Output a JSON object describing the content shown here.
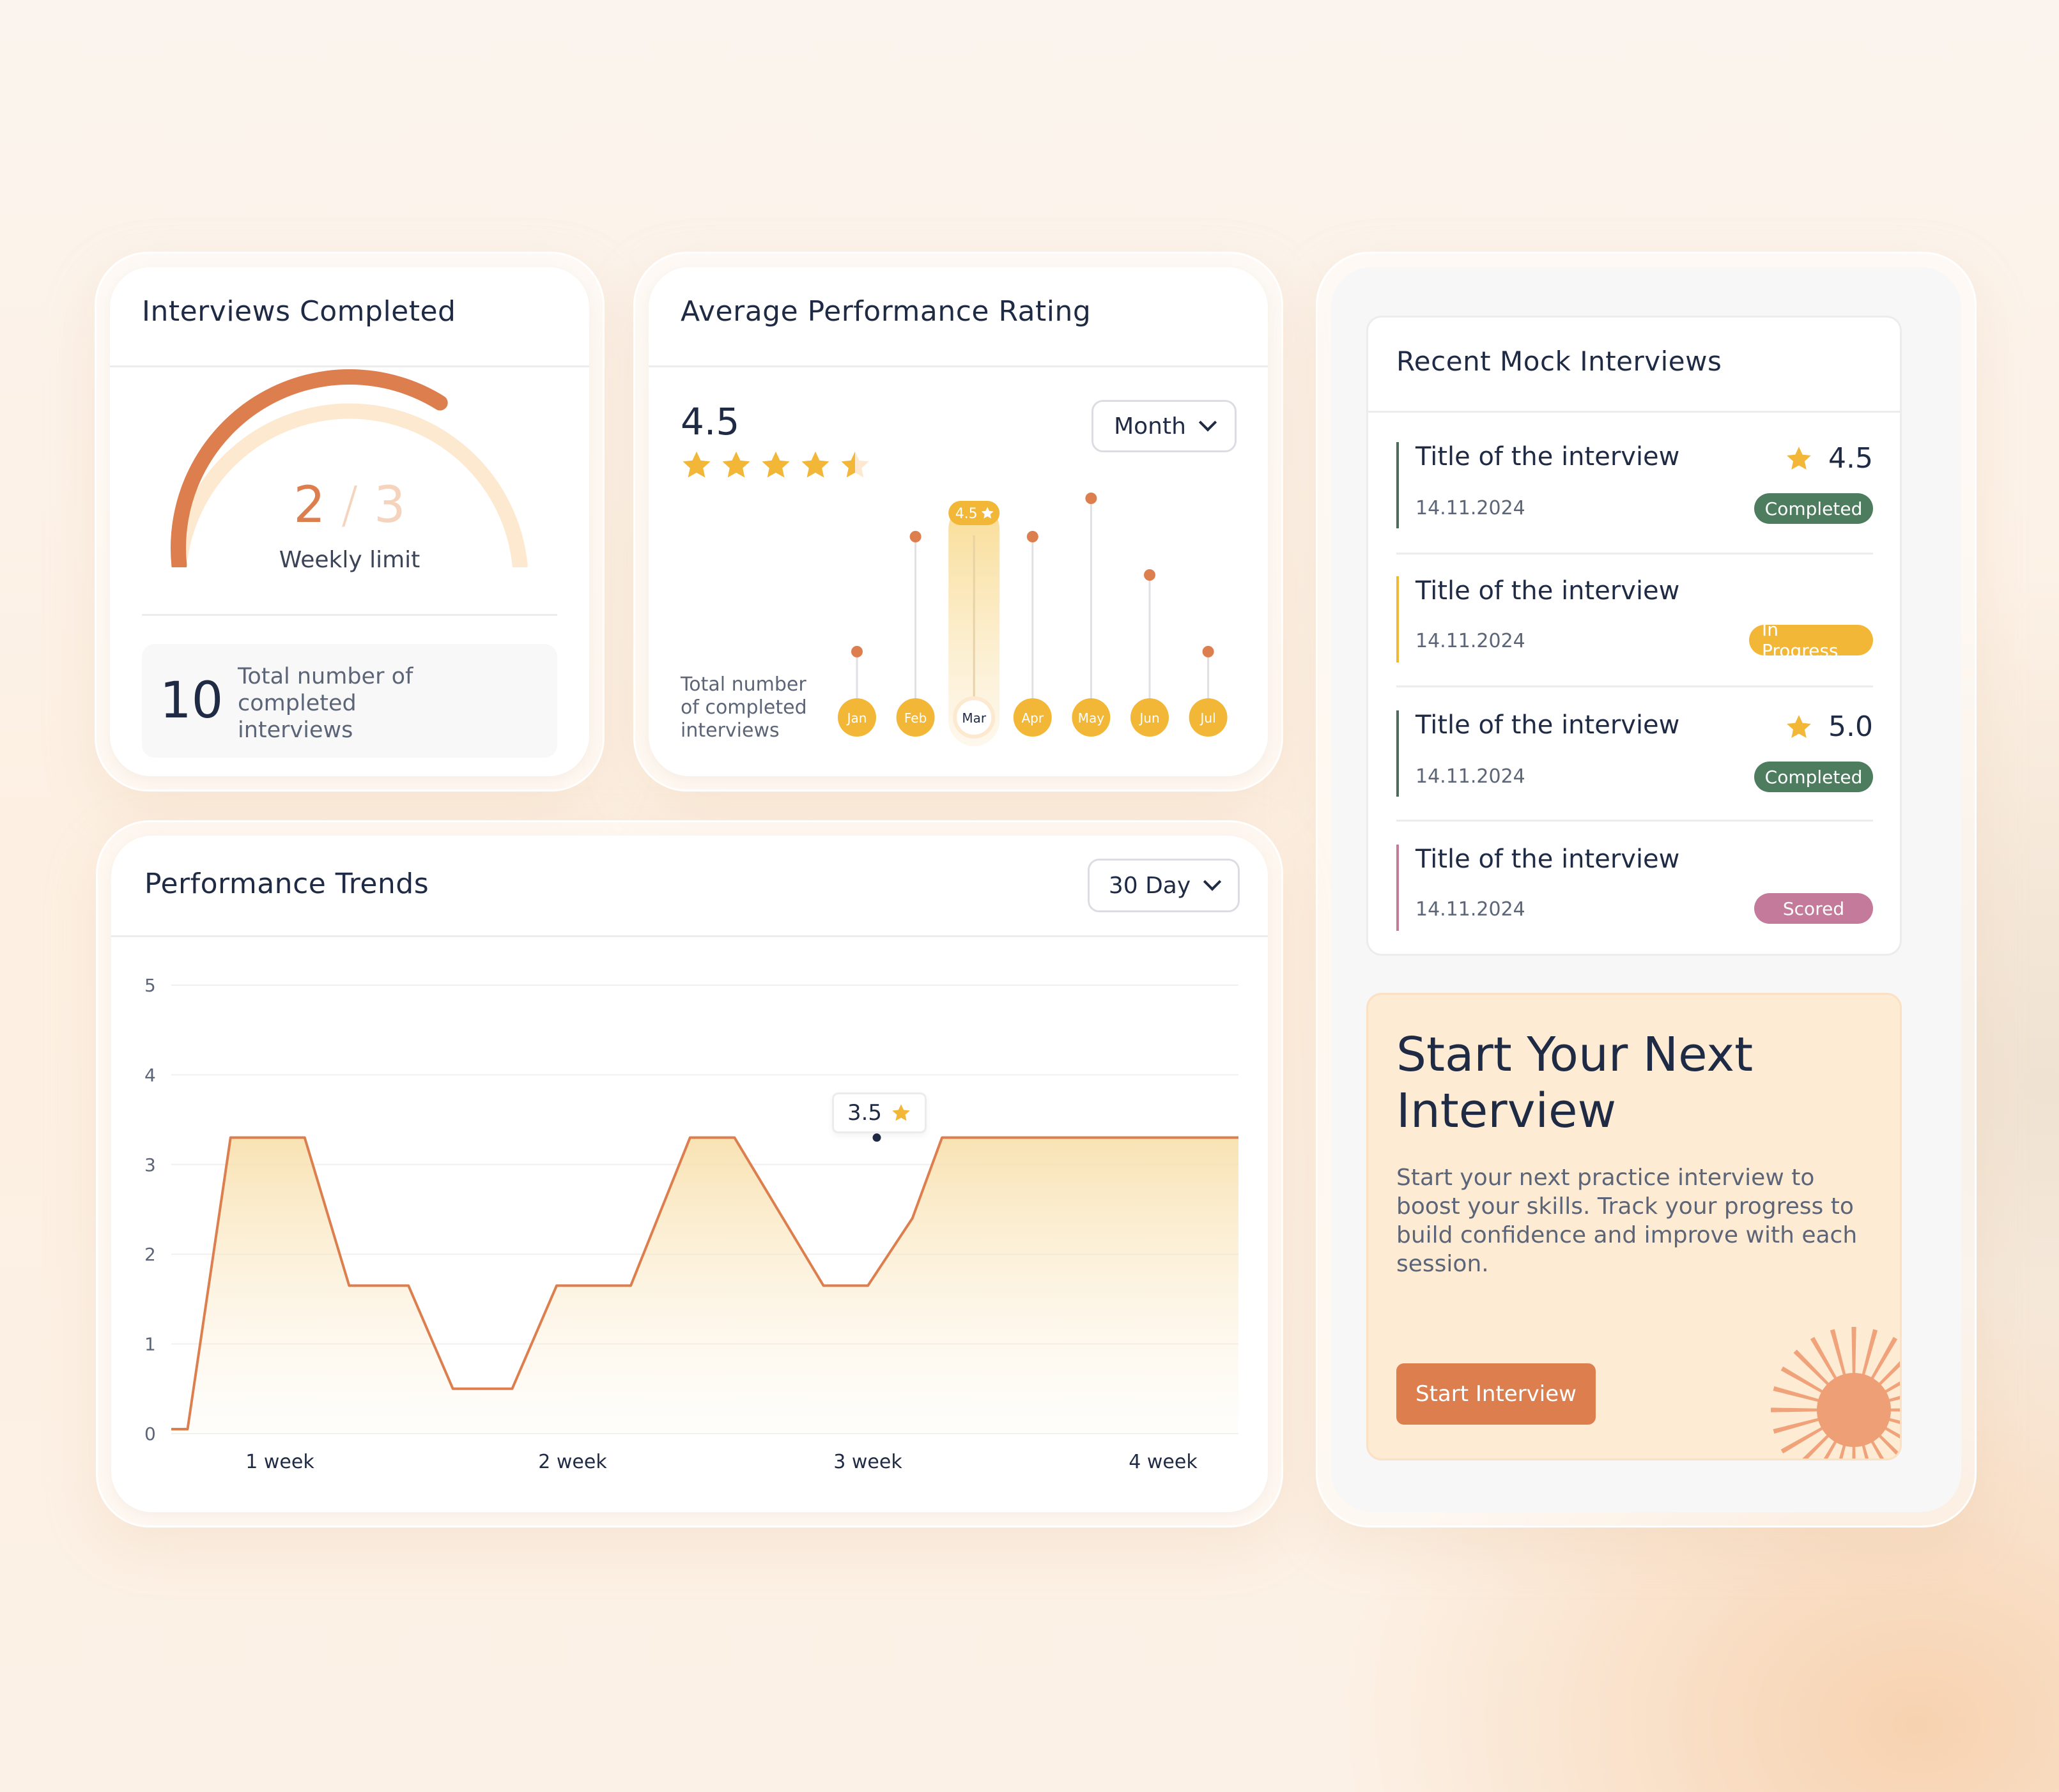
{
  "interviews_completed": {
    "title": "Interviews Completed",
    "done": "2",
    "separator": "/",
    "limit": "3",
    "progress_fraction": 0.6667,
    "limit_label": "Weekly limit",
    "total_value": "10",
    "total_label": "Total number of completed interviews"
  },
  "avg_rating": {
    "title": "Average Performance Rating",
    "value": "4.5",
    "stars": 4.5,
    "dropdown": "Month",
    "side_label": "Total number of completed interviews",
    "chart_data": {
      "type": "scatter",
      "categories": [
        "Jan",
        "Feb",
        "Mar",
        "Apr",
        "May",
        "Jun",
        "Jul"
      ],
      "values": [
        3.1,
        4.0,
        4.5,
        4.0,
        4.3,
        3.7,
        3.1
      ],
      "selected": "Mar",
      "selected_label": "4.5"
    }
  },
  "trends": {
    "title": "Performance Trends",
    "dropdown": "30 Day",
    "tooltip_value": "3.5",
    "chart_data": {
      "type": "area",
      "ylim": [
        0,
        5
      ],
      "yticks": [
        "5",
        "4",
        "3",
        "2",
        "1",
        "0"
      ],
      "xticks": [
        "1 week",
        "2 week",
        "3 week",
        "4 week"
      ],
      "x": [
        0,
        0.11,
        0.4,
        0.9,
        1.2,
        1.6,
        1.9,
        2.3,
        2.6,
        3.1,
        3.5,
        3.8,
        4.4,
        4.7,
        5.0,
        5.2,
        5.6,
        5.9,
        6.9,
        7.2
      ],
      "y": [
        0.05,
        0.05,
        3.3,
        3.3,
        1.65,
        1.65,
        0.5,
        0.5,
        1.65,
        1.65,
        3.3,
        3.3,
        1.65,
        1.65,
        2.4,
        3.3,
        3.3,
        3.3,
        3.3,
        3.3
      ],
      "highlight_index": 11
    }
  },
  "recent": {
    "title": "Recent Mock Interviews",
    "items": [
      {
        "title": "Title of the interview",
        "date": "14.11.2024",
        "rating": "4.5",
        "status": "Completed",
        "status_color": "#4d7c5f",
        "accent": "#4d6a5c"
      },
      {
        "title": "Title of the interview",
        "date": "14.11.2024",
        "rating": "",
        "status": "In Progress",
        "status_color": "#f2b736",
        "accent": "#f2b736"
      },
      {
        "title": "Title of the interview",
        "date": "14.11.2024",
        "rating": "5.0",
        "status": "Completed",
        "status_color": "#4d7c5f",
        "accent": "#4d6a5c"
      },
      {
        "title": "Title of the interview",
        "date": "14.11.2024",
        "rating": "",
        "status": "Scored",
        "status_color": "#c47a9a",
        "accent": "#c47a9a"
      }
    ]
  },
  "cta": {
    "title": "Start Your Next Interview",
    "body": "Start your next practice interview to boost your skills. Track your progress to build confidence and improve with each session.",
    "button": "Start Interview"
  },
  "colors": {
    "accent": "#dd7e4e",
    "accent_light": "#fde9cf",
    "star": "#f2b736",
    "text": "#1f2a44"
  }
}
